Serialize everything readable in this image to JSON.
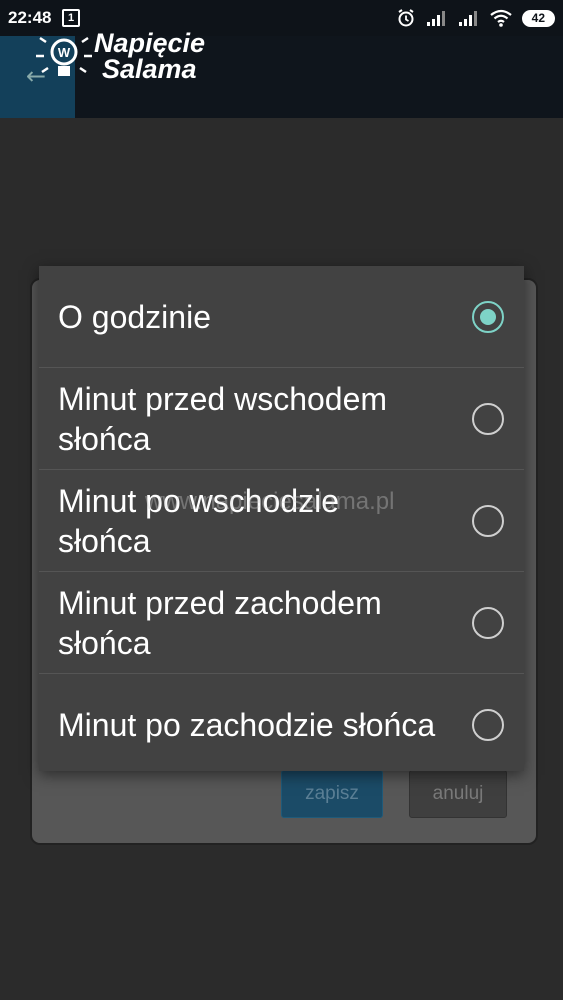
{
  "status_bar": {
    "time": "22:48",
    "sim_indicator": "1",
    "battery": "42",
    "icons": [
      "alarm-icon",
      "signal-icon",
      "signal-icon",
      "wifi-icon",
      "battery-icon"
    ]
  },
  "app_bar": {
    "logo_line1": "Napięcie",
    "logo_line2": "Salama",
    "back_icon": "arrow-left-icon"
  },
  "dialog": {
    "options": [
      {
        "label": "O godzinie",
        "selected": true
      },
      {
        "label": "Minut przed wschodem słońca",
        "selected": false
      },
      {
        "label": "Minut po wschodzie słońca",
        "selected": false
      },
      {
        "label": "Minut przed zachodem słońca",
        "selected": false
      },
      {
        "label": "Minut po zachodzie słońca",
        "selected": false
      }
    ]
  },
  "background_buttons": {
    "save": "zapisz",
    "cancel": "anuluj"
  },
  "watermark": "www.napieciesalama.pl",
  "colors": {
    "accent": "#7ed3c7",
    "dialog_bg": "#424242",
    "statusbar_bg": "#0e1319"
  }
}
